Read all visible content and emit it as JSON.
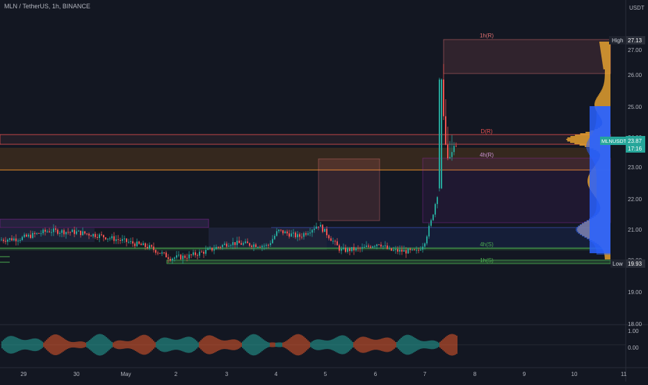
{
  "header": {
    "title": "MLN / TetherUS, 1h, BINANCE",
    "currency": "USDT"
  },
  "price_axis": {
    "labels": [
      "27.00",
      "26.00",
      "25.00",
      "24.00",
      "23.00",
      "22.00",
      "21.00",
      "20.00",
      "19.00",
      "18.00"
    ],
    "high_label": "High",
    "high_value": "27.13",
    "low_label": "Low",
    "low_value": "19.93",
    "symbol_label": "MLNUSDT",
    "current_price": "23.87",
    "countdown": "17:16"
  },
  "indicator_axis": {
    "labels": [
      "1.00",
      "0.00"
    ]
  },
  "time_axis": {
    "labels": [
      "29",
      "30",
      "May",
      "2",
      "3",
      "4",
      "5",
      "6",
      "7",
      "8",
      "9",
      "10",
      "11"
    ]
  },
  "zone_labels": [
    "1h(R)",
    "D(R)",
    "4h(R)",
    "4h(S)",
    "1h(S)"
  ],
  "colors": {
    "background": "#131722",
    "bull": "#26a69a",
    "bear": "#ef5350",
    "resistance": "#e57373",
    "support": "#4caf50",
    "volume_profile_orange": "#f0a830",
    "volume_profile_blue": "#2962ff",
    "current_price_tag": "#26a69a"
  }
}
